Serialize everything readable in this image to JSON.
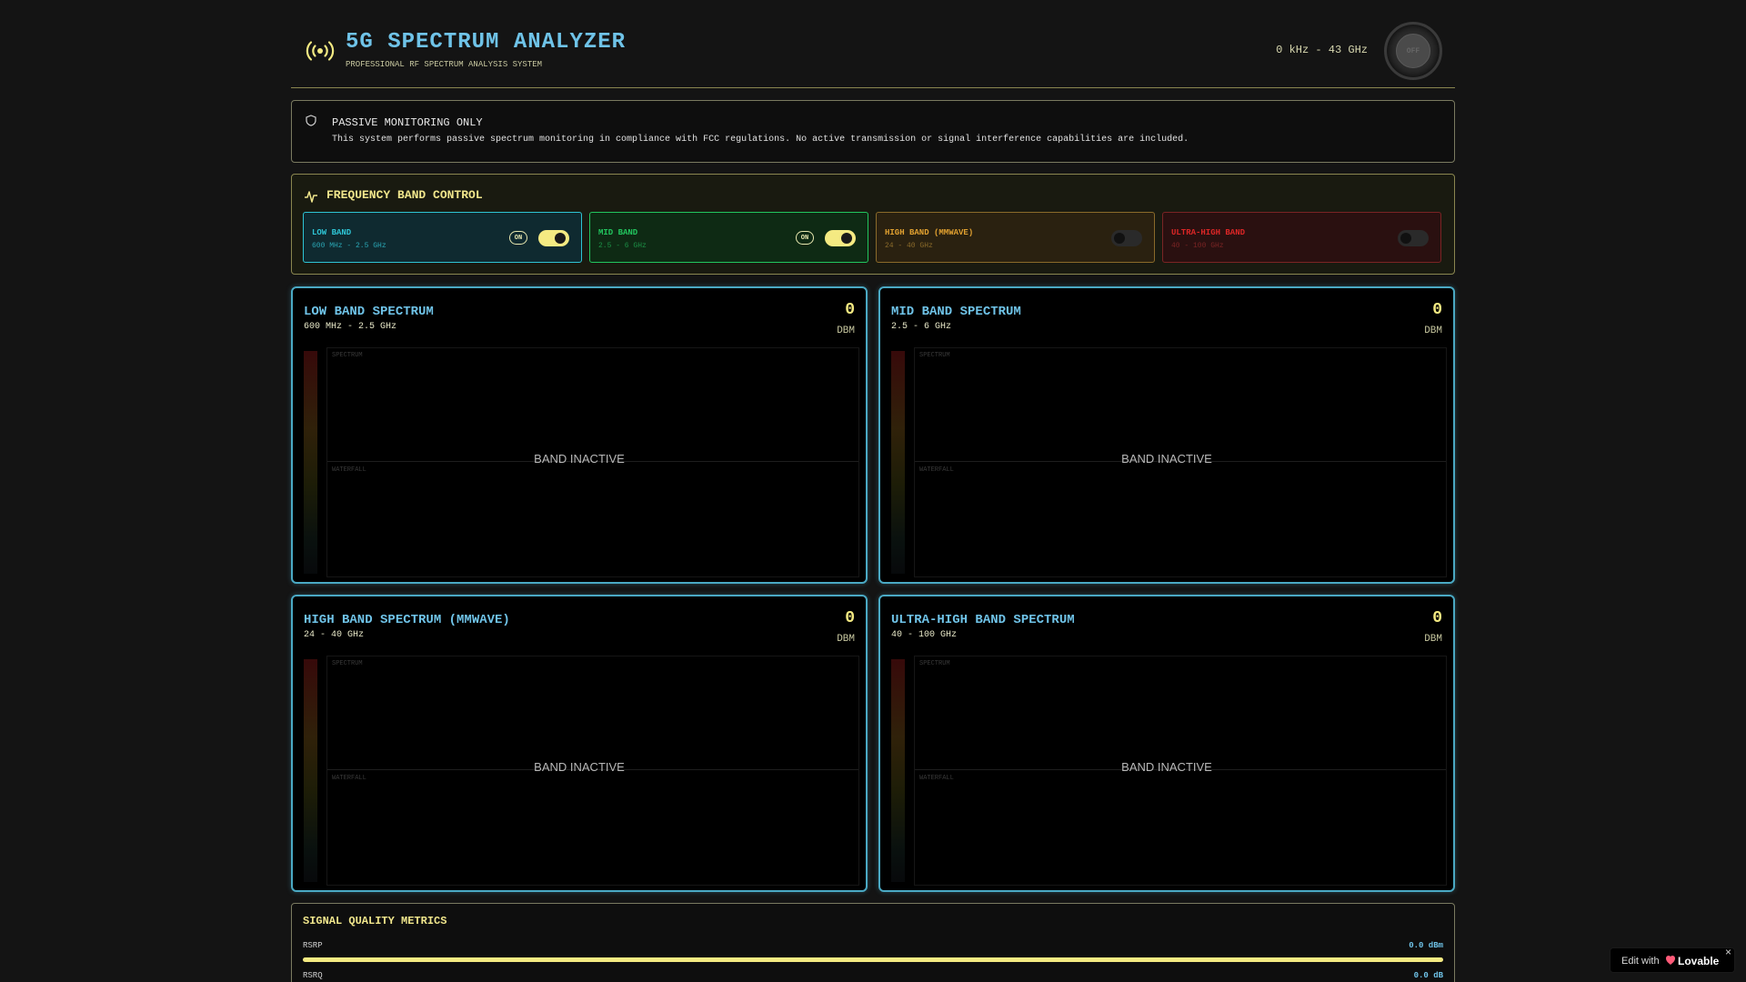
{
  "header": {
    "title": "5G SPECTRUM ANALYZER",
    "subtitle": "PROFESSIONAL RF SPECTRUM ANALYSIS SYSTEM",
    "freq_range": "0 kHz - 43 GHz",
    "power_label": "OFF",
    "logo_icon": "radio-broadcast-icon"
  },
  "notice": {
    "icon": "shield-icon",
    "title": "PASSIVE MONITORING ONLY",
    "text": "This system performs passive spectrum monitoring in compliance with FCC regulations. No active transmission or signal interference capabilities are included."
  },
  "band_control": {
    "icon": "activity-pulse-icon",
    "title": "FREQUENCY BAND CONTROL",
    "bands": [
      {
        "name": "LOW BAND",
        "range": "600 MHz - 2.5 GHz",
        "enabled": true,
        "badge": "ON",
        "color": "#2ec4d4"
      },
      {
        "name": "MID BAND",
        "range": "2.5 - 6 GHz",
        "enabled": true,
        "badge": "ON",
        "color": "#22c55e"
      },
      {
        "name": "HIGH BAND (MMWAVE)",
        "range": "24 - 40 GHz",
        "enabled": false,
        "badge": "",
        "color": "#e0a030"
      },
      {
        "name": "ULTRA-HIGH BAND",
        "range": "40 - 100 GHz",
        "enabled": false,
        "badge": "",
        "color": "#dc2626"
      }
    ]
  },
  "panels": [
    {
      "title": "LOW BAND SPECTRUM",
      "range": "600 MHz - 2.5 GHz",
      "value": "0",
      "unit": "DBM",
      "status": "BAND INACTIVE",
      "spectrum_label": "SPECTRUM",
      "waterfall_label": "WATERFALL"
    },
    {
      "title": "MID BAND SPECTRUM",
      "range": "2.5 - 6 GHz",
      "value": "0",
      "unit": "DBM",
      "status": "BAND INACTIVE",
      "spectrum_label": "SPECTRUM",
      "waterfall_label": "WATERFALL"
    },
    {
      "title": "HIGH BAND SPECTRUM (MMWAVE)",
      "range": "24 - 40 GHz",
      "value": "0",
      "unit": "DBM",
      "status": "BAND INACTIVE",
      "spectrum_label": "SPECTRUM",
      "waterfall_label": "WATERFALL"
    },
    {
      "title": "ULTRA-HIGH BAND SPECTRUM",
      "range": "40 - 100 GHz",
      "value": "0",
      "unit": "DBM",
      "status": "BAND INACTIVE",
      "spectrum_label": "SPECTRUM",
      "waterfall_label": "WATERFALL"
    }
  ],
  "metrics": {
    "title": "SIGNAL QUALITY METRICS",
    "items": [
      {
        "label": "RSRP",
        "value": "0.0 dBm",
        "fill": 1.0
      },
      {
        "label": "RSRQ",
        "value": "0.0 dB",
        "fill": 1.0
      }
    ]
  },
  "badge": {
    "edit_label": "Edit with",
    "brand": "Lovable",
    "close": "×"
  },
  "colors": {
    "accent_yellow": "#f4ea82",
    "accent_cyan": "#6fc3e8",
    "panel_border": "#4aa9c4"
  }
}
